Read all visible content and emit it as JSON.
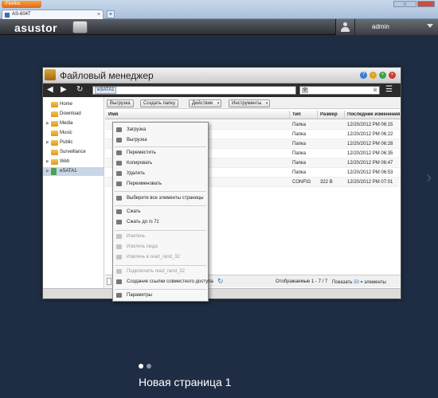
{
  "browser": {
    "firefox_label": "Firefox",
    "tab_title": "AS-604T",
    "new_tab_label": "+",
    "close_symbol": "×"
  },
  "app": {
    "logo": "asustor",
    "user_name": "admin"
  },
  "desktop": {
    "page_label": "Новая страница 1",
    "next_arrow": "›"
  },
  "file_manager": {
    "title": "Файловый менеджер",
    "path_segment": "eSATA1",
    "nav": {
      "back": "◀",
      "forward": "▶",
      "refresh": "↻",
      "list": "☰"
    },
    "filter_icon": "⚲",
    "filter_clear": "⊗",
    "sidebar": [
      {
        "label": "Home",
        "expandable": false
      },
      {
        "label": "Download",
        "expandable": false
      },
      {
        "label": "Media",
        "expandable": true
      },
      {
        "label": "Music",
        "expandable": false
      },
      {
        "label": "Public",
        "expandable": true
      },
      {
        "label": "Surveillance",
        "expandable": false
      },
      {
        "label": "Web",
        "expandable": true
      },
      {
        "label": "eSATA1",
        "expandable": true,
        "selected": true
      }
    ],
    "toolbar": {
      "upload": "Выгрузка",
      "create_folder": "Создать папку",
      "action": "Действие",
      "tools": "Инструменты"
    },
    "columns": {
      "name": "Имя",
      "type": "Тип",
      "size": "Размер",
      "modified": "Последние изменения"
    },
    "rows": [
      {
        "type": "Папка",
        "size": "",
        "modified": "12/20/2012 PM 06:15"
      },
      {
        "type": "Папка",
        "size": "",
        "modified": "12/20/2012 PM 06:22"
      },
      {
        "type": "Папка",
        "size": "",
        "modified": "12/20/2012 PM 06:28"
      },
      {
        "type": "Папка",
        "size": "",
        "modified": "12/20/2012 PM 06:35"
      },
      {
        "type": "Папка",
        "size": "",
        "modified": "12/20/2012 PM 06:47"
      },
      {
        "type": "Папка",
        "size": "",
        "modified": "12/20/2012 PM 06:53"
      },
      {
        "type": "CONFIG",
        "size": "322 B",
        "modified": "12/20/2012 PM 07:01"
      }
    ],
    "status": {
      "displayed": "Отображаемые 1 - 7 / 7",
      "show_label": "Показать",
      "show_count": "50",
      "items_label": "элементы"
    }
  },
  "context_menu": [
    {
      "label": "Загрузка",
      "disabled": false
    },
    {
      "label": "Выгрузка",
      "disabled": false
    },
    {
      "sep": true
    },
    {
      "label": "Переместить",
      "disabled": false
    },
    {
      "label": "Копировать",
      "disabled": false
    },
    {
      "label": "Удалить",
      "disabled": false
    },
    {
      "label": "Переименовать",
      "disabled": false
    },
    {
      "sep": true
    },
    {
      "label": "Выберите все элементы страницы",
      "disabled": false
    },
    {
      "sep": true
    },
    {
      "label": "Сжать",
      "disabled": false
    },
    {
      "label": "Сжать до rs 7z",
      "disabled": false
    },
    {
      "sep": true
    },
    {
      "label": "Извлечь",
      "disabled": true
    },
    {
      "label": "Извлечь сюда",
      "disabled": true
    },
    {
      "label": "Извлечь в read_rand_32",
      "disabled": true
    },
    {
      "sep": true
    },
    {
      "label": "Подключить read_rand_32",
      "disabled": true
    },
    {
      "label": "Создание ссылки совместного доступа",
      "disabled": false
    },
    {
      "sep": true
    },
    {
      "label": "Параметры",
      "disabled": false
    }
  ]
}
